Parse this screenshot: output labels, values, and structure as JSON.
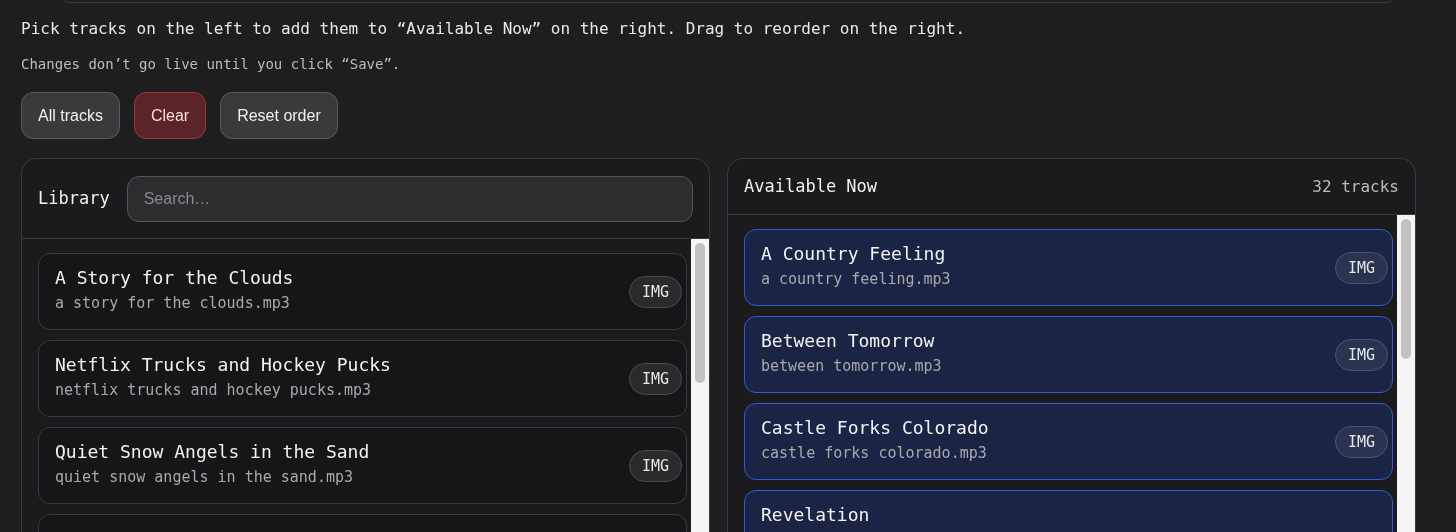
{
  "intro": "Pick tracks on the left to add them to “Available Now” on the right. Drag to reorder on the right.",
  "note": "Changes don’t go live until you click “Save”.",
  "buttons": [
    {
      "label": "All tracks",
      "kind": "neutral"
    },
    {
      "label": "Clear",
      "kind": "danger"
    },
    {
      "label": "Reset order",
      "kind": "neutral"
    }
  ],
  "library": {
    "title": "Library",
    "search": {
      "placeholder": "Search…"
    },
    "items": [
      {
        "title": "A Story for the Clouds",
        "file": "a story for the clouds.mp3",
        "badge": "IMG",
        "selected": false
      },
      {
        "title": "Netflix Trucks and Hockey Pucks",
        "file": "netflix trucks and hockey pucks.mp3",
        "badge": "IMG",
        "selected": false
      },
      {
        "title": "Quiet Snow Angels in the Sand",
        "file": "quiet snow angels in the sand.mp3",
        "badge": "IMG",
        "selected": false
      },
      {
        "selected": false
      }
    ]
  },
  "available": {
    "title": "Available Now",
    "count": "32 tracks",
    "items": [
      {
        "title": "A Country Feeling",
        "file": "a country feeling.mp3",
        "badge": "IMG",
        "selected": true
      },
      {
        "title": "Between Tomorrow",
        "file": "between tomorrow.mp3",
        "badge": "IMG",
        "selected": true
      },
      {
        "title": "Castle Forks Colorado",
        "file": "castle forks colorado.mp3",
        "badge": "IMG",
        "selected": true
      },
      {
        "title": "Revelation",
        "selected": true
      }
    ]
  }
}
